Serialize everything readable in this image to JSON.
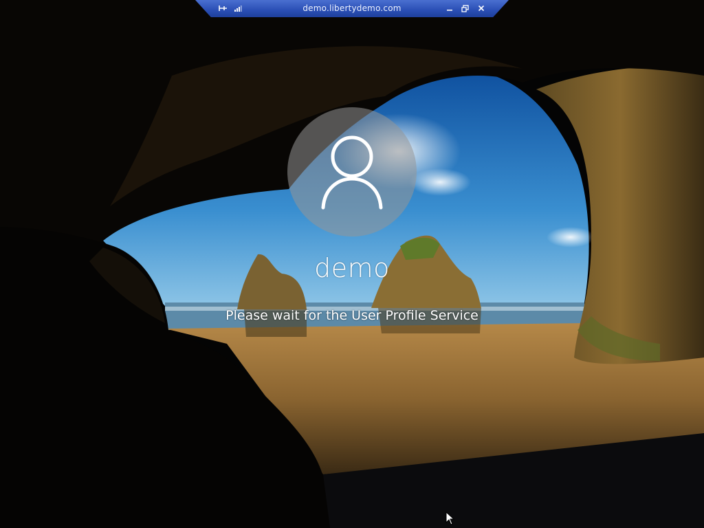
{
  "rdp_bar": {
    "host": "demo.libertydemo.com",
    "icons": [
      "pin-icon",
      "signal-bars-icon",
      "minimize-icon",
      "restore-icon",
      "close-icon"
    ]
  },
  "lock_screen": {
    "user_name": "demo",
    "status_message": "Please wait for the User Profile Service",
    "avatar_icon": "user-silhouette-icon"
  },
  "colors": {
    "rdp_bar": "#2a4fb5",
    "text": "#ffffff"
  }
}
